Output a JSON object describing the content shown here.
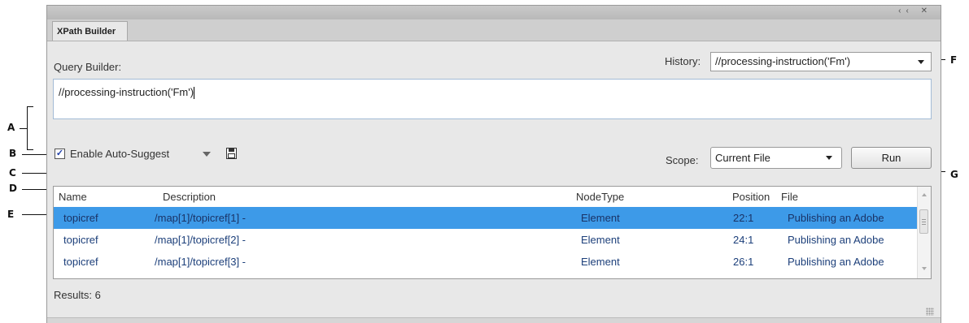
{
  "panel": {
    "tab_label": "XPath Builder",
    "header_buttons": "‹‹ ✕"
  },
  "query_builder": {
    "label": "Query Builder:",
    "query_text": "//processing-instruction('Fm')"
  },
  "history": {
    "label": "History:",
    "selected": "//processing-instruction('Fm')"
  },
  "auto_suggest": {
    "label": "Enable Auto-Suggest",
    "checked": true
  },
  "scope": {
    "label": "Scope:",
    "selected": "Current File"
  },
  "run_button": {
    "label": "Run"
  },
  "results": {
    "columns": [
      "Name",
      "Description",
      "NodeType",
      "Position",
      "File"
    ],
    "rows": [
      {
        "name": "topicref",
        "description": "/map[1]/topicref[1] -",
        "nodetype": "Element",
        "position": "22:1",
        "file": "Publishing an Adobe"
      },
      {
        "name": "topicref",
        "description": "/map[1]/topicref[2] -",
        "nodetype": "Element",
        "position": "24:1",
        "file": "Publishing an Adobe"
      },
      {
        "name": "topicref",
        "description": "/map[1]/topicref[3] -",
        "nodetype": "Element",
        "position": "26:1",
        "file": "Publishing an Adobe"
      }
    ],
    "count_text": "Results: 6"
  },
  "callouts": {
    "a": "A",
    "b": "B",
    "c": "C",
    "d": "D",
    "e": "E",
    "f": "F",
    "g": "G"
  },
  "colors": {
    "selection": "#3d9ae8",
    "row_text": "#1c3f7a",
    "panel_bg": "#e8e8e8"
  }
}
